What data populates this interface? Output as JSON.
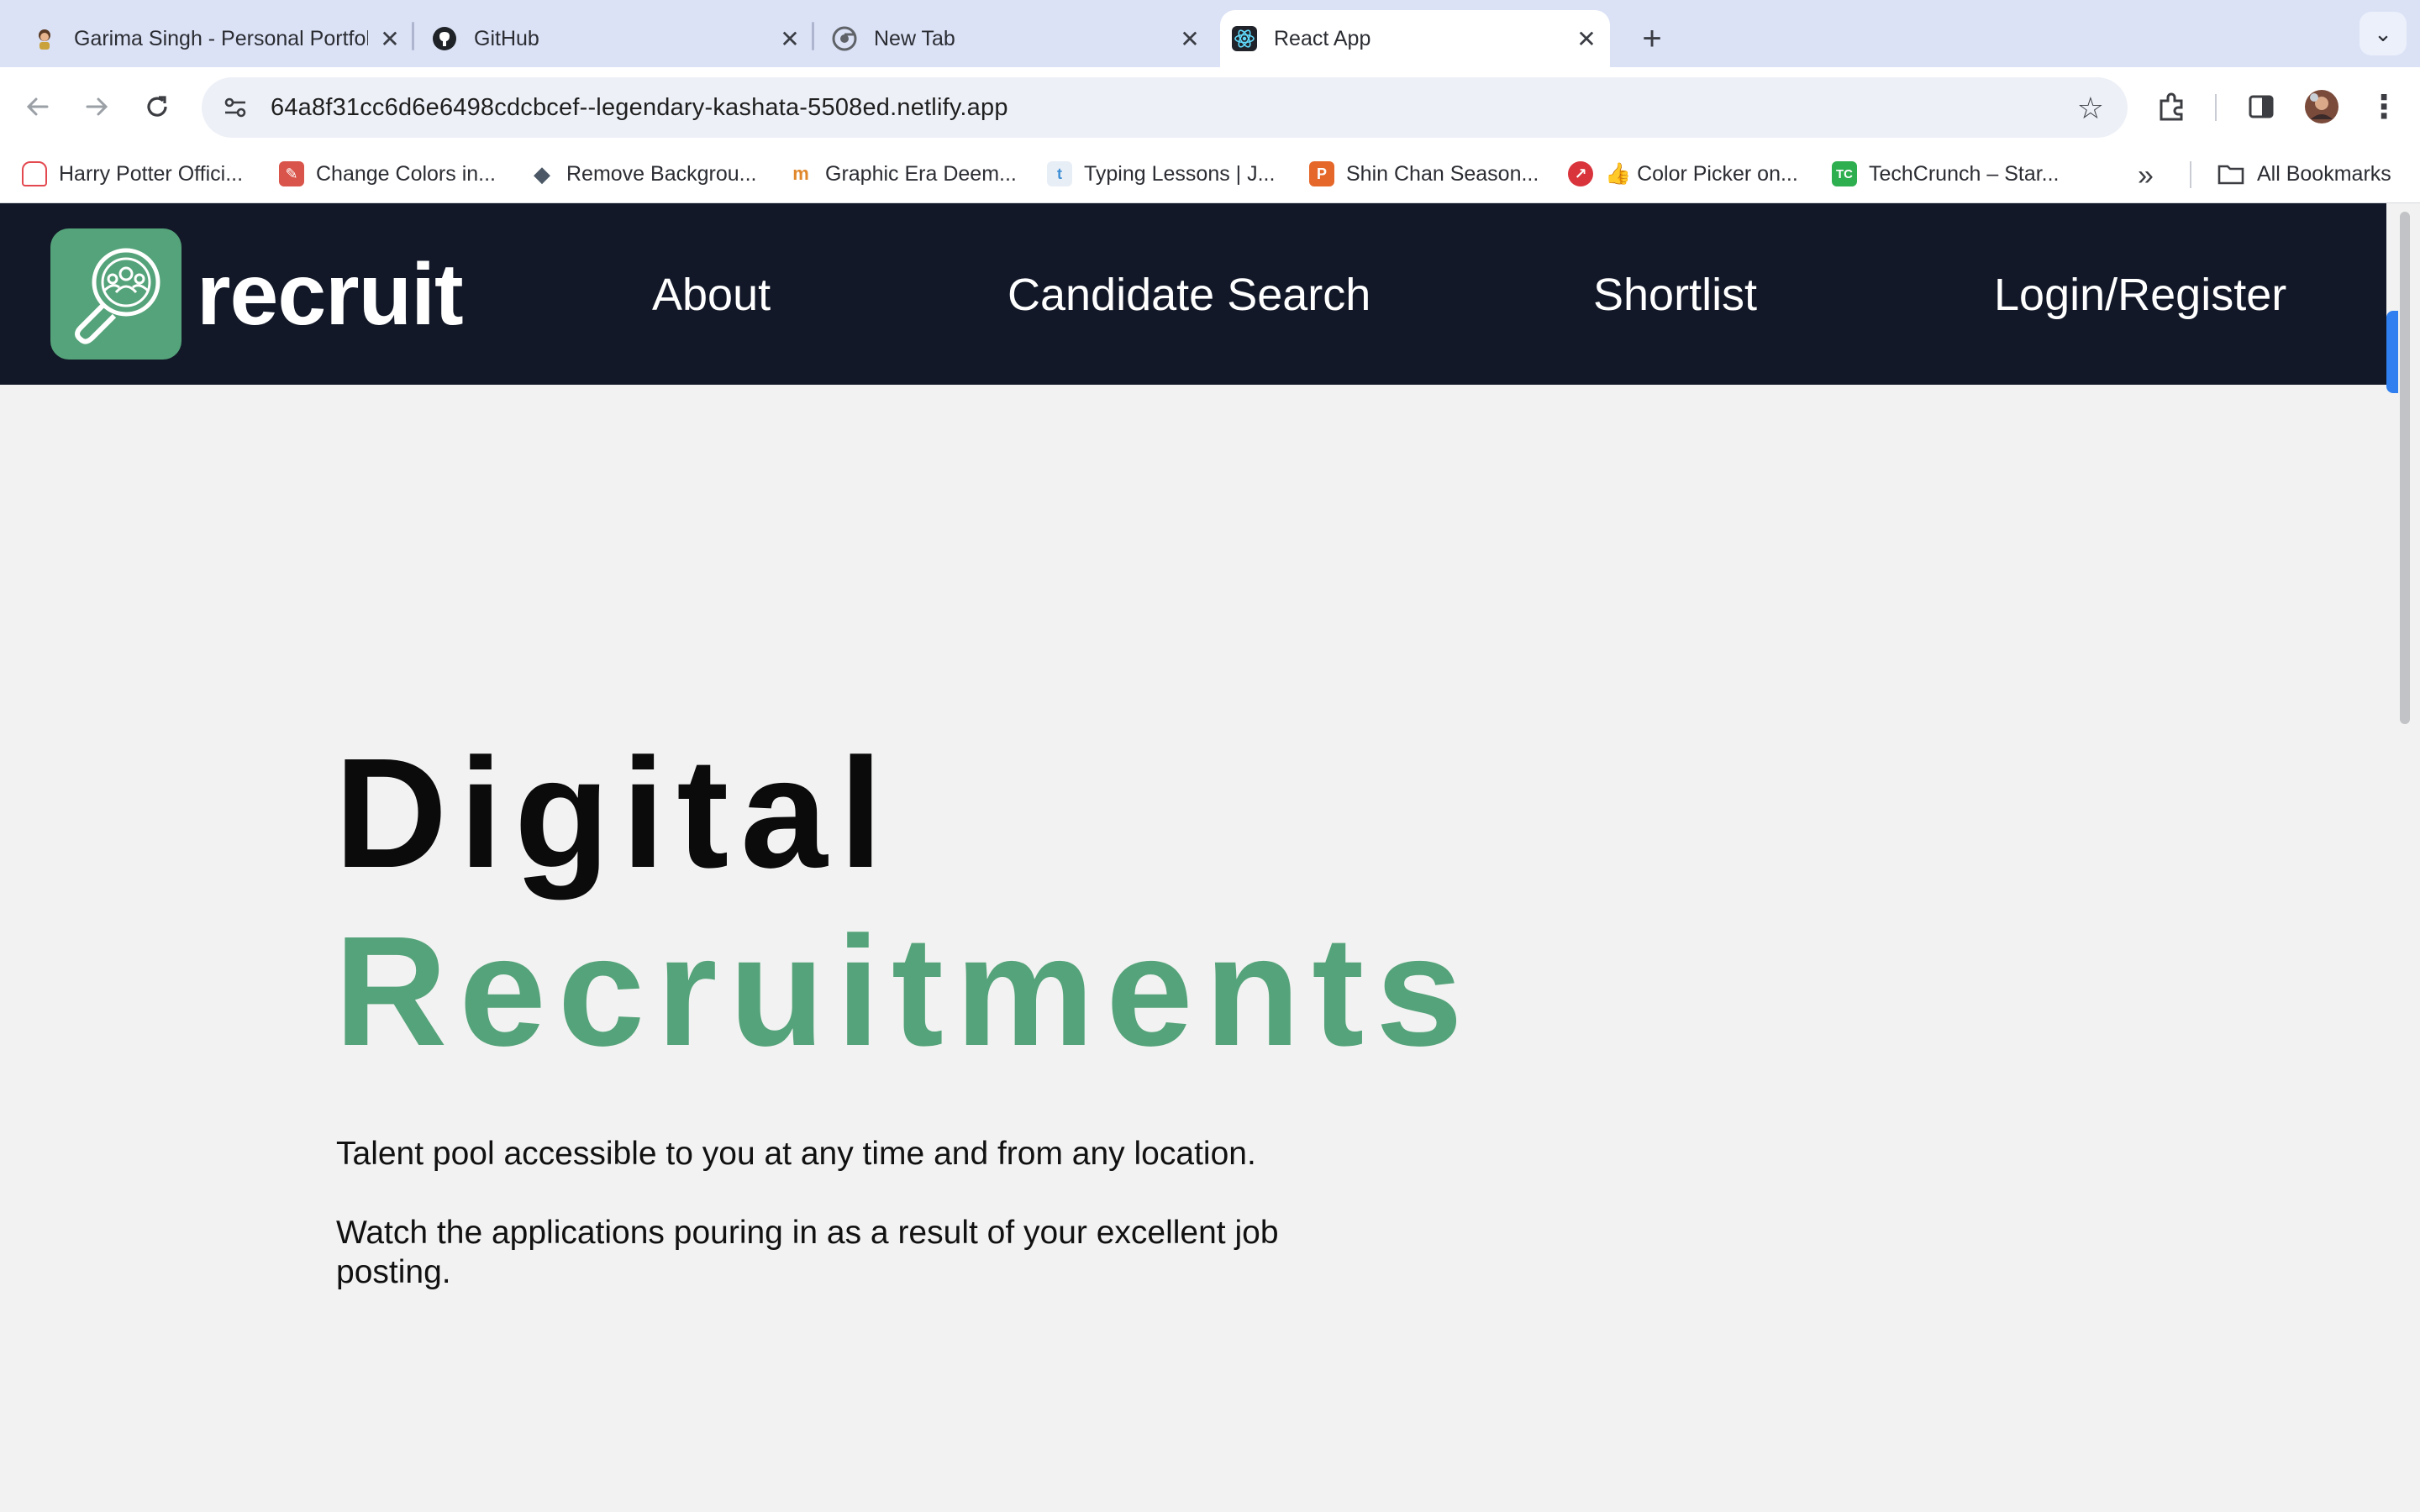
{
  "browser": {
    "tabs": [
      {
        "title": "Garima Singh - Personal Portfolio",
        "icon": "avatar-favicon-icon",
        "active": false
      },
      {
        "title": "GitHub",
        "icon": "github-icon",
        "active": false
      },
      {
        "title": "New Tab",
        "icon": "chrome-icon",
        "active": false
      },
      {
        "title": "React App",
        "icon": "react-icon",
        "active": true
      }
    ],
    "new_tab_label": "+",
    "url": "64a8f31cc6d6e6498cdcbcef--legendary-kashata-5508ed.netlify.app",
    "bookmarks": [
      {
        "label": "Harry Potter Offici...",
        "icon": "harry-potter-icon",
        "color": "#e3484f"
      },
      {
        "label": "Change Colors in...",
        "icon": "tool-icon",
        "color": "#d9544a"
      },
      {
        "label": "Remove Backgrou...",
        "icon": "layers-icon",
        "color": "#4c5866"
      },
      {
        "label": "Graphic Era Deem...",
        "icon": "graduation-cap-icon",
        "color": "#e0872b"
      },
      {
        "label": "Typing Lessons | J...",
        "icon": "typing-icon",
        "color": "#3f8fd6"
      },
      {
        "label": "Shin Chan Season...",
        "icon": "p-icon",
        "color": "#e5672a"
      },
      {
        "label": "👍 Color Picker on...",
        "icon": "color-picker-icon",
        "color": "#d9343c"
      },
      {
        "label": "TechCrunch – Star...",
        "icon": "techcrunch-icon",
        "color": "#2dae4f"
      }
    ],
    "more_bookmarks": "»",
    "all_bookmarks_label": "All Bookmarks"
  },
  "site": {
    "brand": "recruit",
    "nav": [
      "About",
      "Candidate Search",
      "Shortlist",
      "Login/Register"
    ],
    "colors": {
      "navbar": "#121828",
      "accent": "#55a37a",
      "background": "#f1f2f1"
    },
    "hero": {
      "line1": "Digital",
      "line2": "Recruitments",
      "para1": "Talent pool accessible to you at any time and from any location.",
      "para2": "Watch the applications pouring in as a result of your excellent job posting."
    }
  }
}
